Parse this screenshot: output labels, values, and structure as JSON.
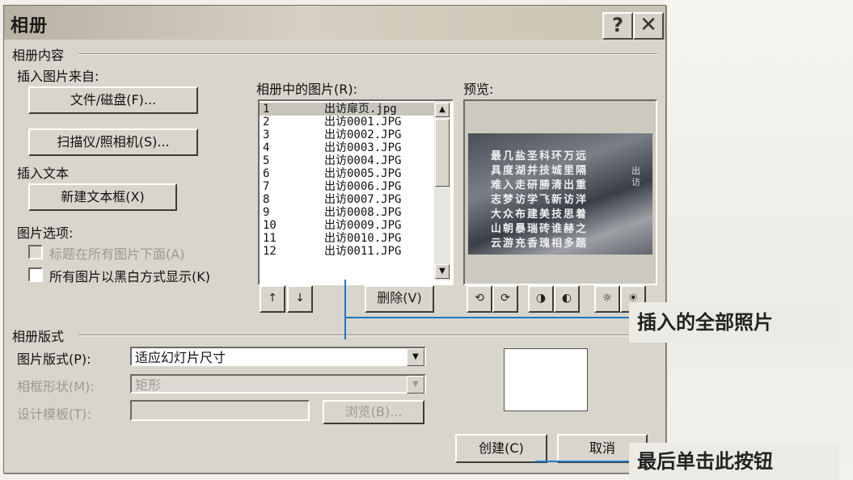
{
  "window": {
    "title": "相册"
  },
  "sections": {
    "album_content": "相册内容",
    "insert_from": "插入图片来自:",
    "insert_text": "插入文本",
    "picture_options": "图片选项:",
    "album_layout": "相册版式"
  },
  "buttons": {
    "file_disk": "文件/磁盘(F)...",
    "scanner_camera": "扫描仪/照相机(S)...",
    "new_text_box": "新建文本框(X)",
    "delete": "删除(V)",
    "browse": "浏览(B)...",
    "create": "创建(C)",
    "cancel": "取消"
  },
  "options": {
    "captions_below": "标题在所有图片下面(A)",
    "black_white": "所有图片以黑白方式显示(K)"
  },
  "list": {
    "label": "相册中的图片(R):",
    "items": [
      {
        "num": "1",
        "name": "出访扉页.jpg"
      },
      {
        "num": "2",
        "name": "出访0001.JPG"
      },
      {
        "num": "3",
        "name": "出访0002.JPG"
      },
      {
        "num": "4",
        "name": "出访0003.JPG"
      },
      {
        "num": "5",
        "name": "出访0004.JPG"
      },
      {
        "num": "6",
        "name": "出访0005.JPG"
      },
      {
        "num": "7",
        "name": "出访0006.JPG"
      },
      {
        "num": "8",
        "name": "出访0007.JPG"
      },
      {
        "num": "9",
        "name": "出访0008.JPG"
      },
      {
        "num": "10",
        "name": "出访0009.JPG"
      },
      {
        "num": "11",
        "name": "出访0010.JPG"
      },
      {
        "num": "12",
        "name": "出访0011.JPG"
      }
    ],
    "selected_index": 0
  },
  "preview": {
    "label": "预览:",
    "poem_lines": [
      "最几盐圣科环万远",
      "具度湖并技城里隔",
      "难入走研勝清出重",
      "志梦访学飞新访洋",
      "大众布建美技思着",
      "山朝暴瑞砖谁赫之",
      "云游充香瑰相多题"
    ],
    "side_text": "出访"
  },
  "layout": {
    "picture_layout_label": "图片版式(P):",
    "picture_layout_value": "适应幻灯片尺寸",
    "frame_shape_label": "相框形状(M):",
    "frame_shape_value": "矩形",
    "design_template_label": "设计模板(T):"
  },
  "icons": [
    "up-arrow-icon",
    "down-arrow-icon",
    "rotate-left-icon",
    "rotate-right-icon",
    "contrast-up-icon",
    "contrast-down-icon",
    "brightness-up-icon",
    "brightness-down-icon",
    "help-icon",
    "close-icon"
  ],
  "annotations": {
    "all_photos": "插入的全部照片",
    "click_button": "最后单击此按钮"
  },
  "colors": {
    "callout_line": "#1d77c7",
    "dialog_bg": "#d8d5cc"
  }
}
